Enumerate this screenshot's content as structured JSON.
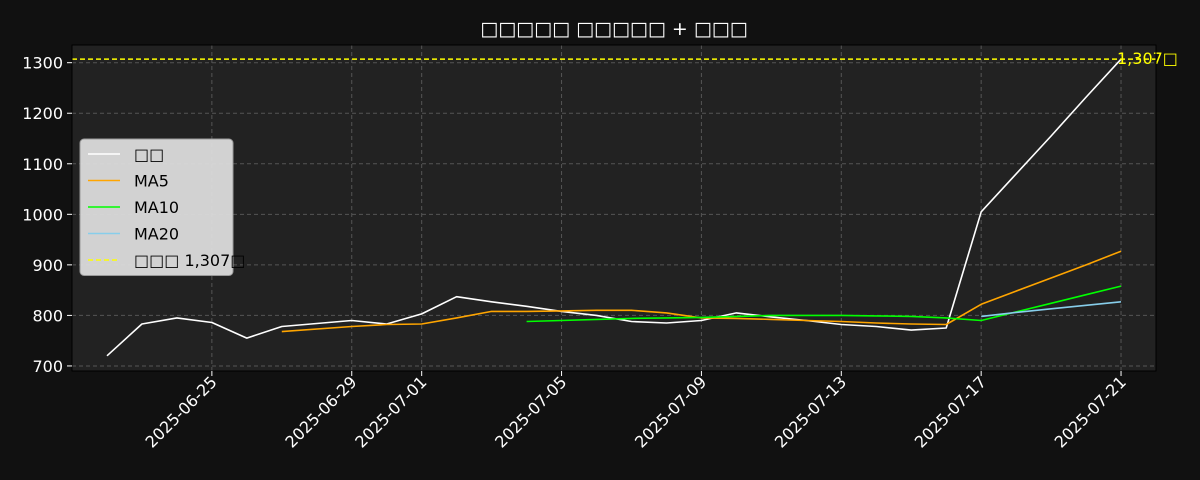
{
  "chart_data": {
    "type": "line",
    "title": "□□□□□ □□□□□ + □□□",
    "xlabel": "",
    "ylabel": "",
    "ylim": [
      690,
      1335
    ],
    "xlim": [
      "2025-06-21",
      "2025-07-22"
    ],
    "yticks": [
      700,
      800,
      900,
      1000,
      1100,
      1200,
      1300
    ],
    "xticks": [
      "2025-06-25",
      "2025-06-29",
      "2025-07-01",
      "2025-07-05",
      "2025-07-09",
      "2025-07-13",
      "2025-07-17",
      "2025-07-21"
    ],
    "grid": true,
    "legend_position": "center-left",
    "series": [
      {
        "name": "□□",
        "color": "#ffffff",
        "x": [
          "2025-06-22",
          "2025-06-23",
          "2025-06-24",
          "2025-06-25",
          "2025-06-26",
          "2025-06-27",
          "2025-06-29",
          "2025-06-30",
          "2025-07-01",
          "2025-07-02",
          "2025-07-03",
          "2025-07-04",
          "2025-07-05",
          "2025-07-06",
          "2025-07-07",
          "2025-07-08",
          "2025-07-09",
          "2025-07-10",
          "2025-07-11",
          "2025-07-12",
          "2025-07-13",
          "2025-07-14",
          "2025-07-15",
          "2025-07-16",
          "2025-07-17",
          "2025-07-18",
          "2025-07-19",
          "2025-07-20",
          "2025-07-21"
        ],
        "values": [
          720,
          783,
          795,
          786,
          755,
          778,
          790,
          783,
          803,
          837,
          827,
          818,
          808,
          800,
          788,
          785,
          790,
          805,
          797,
          790,
          782,
          778,
          771,
          775,
          1005,
          1080,
          1155,
          1232,
          1307
        ]
      },
      {
        "name": "MA5",
        "color": "#ffa500",
        "x": [
          "2025-06-27",
          "2025-06-29",
          "2025-06-30",
          "2025-07-01",
          "2025-07-02",
          "2025-07-03",
          "2025-07-04",
          "2025-07-05",
          "2025-07-06",
          "2025-07-07",
          "2025-07-08",
          "2025-07-09",
          "2025-07-10",
          "2025-07-11",
          "2025-07-12",
          "2025-07-13",
          "2025-07-14",
          "2025-07-15",
          "2025-07-16",
          "2025-07-17",
          "2025-07-18",
          "2025-07-19",
          "2025-07-20",
          "2025-07-21"
        ],
        "values": [
          768,
          778,
          782,
          783,
          795,
          808,
          808,
          809,
          810,
          810,
          805,
          795,
          794,
          792,
          790,
          788,
          785,
          783,
          782,
          822,
          848,
          874,
          900,
          927
        ]
      },
      {
        "name": "MA10",
        "color": "#00ff00",
        "x": [
          "2025-07-04",
          "2025-07-05",
          "2025-07-06",
          "2025-07-07",
          "2025-07-08",
          "2025-07-09",
          "2025-07-10",
          "2025-07-11",
          "2025-07-12",
          "2025-07-13",
          "2025-07-14",
          "2025-07-15",
          "2025-07-16",
          "2025-07-17",
          "2025-07-18",
          "2025-07-19",
          "2025-07-20",
          "2025-07-21"
        ],
        "values": [
          788,
          790,
          792,
          794,
          795,
          796,
          798,
          800,
          800,
          800,
          799,
          798,
          795,
          790,
          807,
          824,
          841,
          858
        ]
      },
      {
        "name": "MA20",
        "color": "#87ceeb",
        "x": [
          "2025-07-17",
          "2025-07-18",
          "2025-07-19",
          "2025-07-20",
          "2025-07-21"
        ],
        "values": [
          798,
          806,
          813,
          820,
          827
        ]
      }
    ],
    "hline": {
      "name": "□□□ 1,307□",
      "value": 1307,
      "color": "#ffff00",
      "label": "1,307□"
    }
  }
}
